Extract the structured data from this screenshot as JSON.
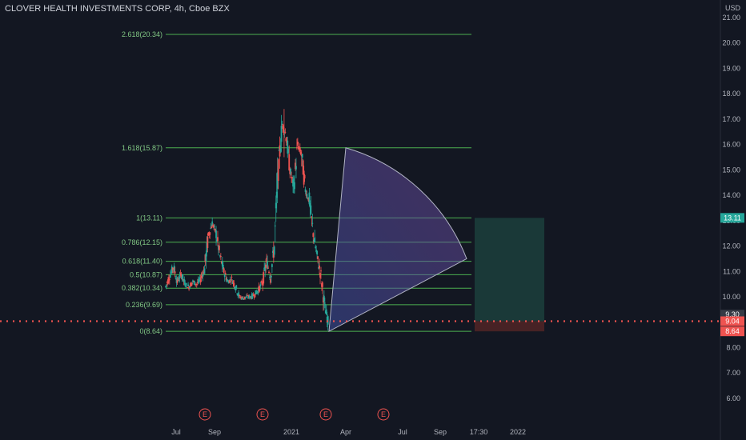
{
  "header": {
    "title": "CLOVER HEALTH INVESTMENTS CORP, 4h, Cboe BZX"
  },
  "axis": {
    "currency": "USD"
  },
  "colors": {
    "background": "#131722",
    "fib_line": "#4caf50",
    "fib_label": "#81c784",
    "candle_up": "#26a69a",
    "candle_down": "#ef5350",
    "price_line": "#ef5350",
    "long_target_zone": "#1a3b3a",
    "long_stop_zone": "#4a2326",
    "arc_fill": "#7b4fa8",
    "axis_text": "#b2b5be"
  },
  "chart_data": {
    "type": "candlestick",
    "symbol": "CLOVER HEALTH INVESTMENTS CORP",
    "interval": "4h",
    "exchange": "Cboe BZX",
    "ylim": [
      5.45,
      21.3
    ],
    "y_ticks": [
      6.0,
      7.0,
      8.0,
      9.0,
      10.0,
      11.0,
      12.0,
      13.0,
      14.0,
      15.0,
      16.0,
      17.0,
      18.0,
      19.0,
      20.0,
      21.0
    ],
    "x_ticks": [
      "Jul",
      "Sep",
      "2021",
      "Apr",
      "Jul",
      "Sep",
      "17:30",
      "2022"
    ],
    "earnings_markers": [
      "E",
      "E",
      "E",
      "E"
    ],
    "fib_levels": [
      {
        "ratio": "0",
        "price": 8.64,
        "label": "0(8.64)"
      },
      {
        "ratio": "0.236",
        "price": 9.69,
        "label": "0.236(9.69)"
      },
      {
        "ratio": "0.382",
        "price": 10.34,
        "label": "0.382(10.34)"
      },
      {
        "ratio": "0.5",
        "price": 10.87,
        "label": "0.5(10.87)"
      },
      {
        "ratio": "0.618",
        "price": 11.4,
        "label": "0.618(11.40)"
      },
      {
        "ratio": "0.786",
        "price": 12.15,
        "label": "0.786(12.15)"
      },
      {
        "ratio": "1",
        "price": 13.11,
        "label": "1(13.11)"
      },
      {
        "ratio": "1.618",
        "price": 15.87,
        "label": "1.618(15.87)"
      },
      {
        "ratio": "2.618",
        "price": 20.34,
        "label": "2.618(20.34)"
      }
    ],
    "price_tags": [
      {
        "value": "13.11",
        "price": 13.11,
        "color": "#26a69a"
      },
      {
        "value": "9.30",
        "price": 9.3,
        "color": "#363a45"
      },
      {
        "value": "9.04",
        "price": 9.04,
        "color": "#ef5350"
      },
      {
        "value": "8.64",
        "price": 8.64,
        "color": "#ef5350"
      }
    ],
    "current_price": 9.04,
    "long_position": {
      "entry": 9.04,
      "target": 13.11,
      "stop": 8.64
    },
    "price_path": [
      [
        0.0,
        10.4
      ],
      [
        0.01,
        10.8
      ],
      [
        0.02,
        11.2
      ],
      [
        0.03,
        10.6
      ],
      [
        0.04,
        10.9
      ],
      [
        0.05,
        10.5
      ],
      [
        0.06,
        10.4
      ],
      [
        0.07,
        10.6
      ],
      [
        0.08,
        10.5
      ],
      [
        0.09,
        10.7
      ],
      [
        0.1,
        11.1
      ],
      [
        0.11,
        12.4
      ],
      [
        0.12,
        12.9
      ],
      [
        0.13,
        12.5
      ],
      [
        0.14,
        11.6
      ],
      [
        0.15,
        11.0
      ],
      [
        0.16,
        10.6
      ],
      [
        0.17,
        10.7
      ],
      [
        0.18,
        10.4
      ],
      [
        0.19,
        10.0
      ],
      [
        0.2,
        9.95
      ],
      [
        0.21,
        10.0
      ],
      [
        0.22,
        10.0
      ],
      [
        0.23,
        10.1
      ],
      [
        0.24,
        10.3
      ],
      [
        0.25,
        10.6
      ],
      [
        0.26,
        11.4
      ],
      [
        0.27,
        10.8
      ],
      [
        0.28,
        12.0
      ],
      [
        0.29,
        15.0
      ],
      [
        0.3,
        16.8
      ],
      [
        0.31,
        16.4
      ],
      [
        0.32,
        15.0
      ],
      [
        0.33,
        14.3
      ],
      [
        0.34,
        16.0
      ],
      [
        0.35,
        15.6
      ],
      [
        0.36,
        14.2
      ],
      [
        0.37,
        13.8
      ],
      [
        0.38,
        12.5
      ],
      [
        0.39,
        11.6
      ],
      [
        0.4,
        10.8
      ],
      [
        0.41,
        9.6
      ],
      [
        0.42,
        8.9
      ]
    ]
  }
}
